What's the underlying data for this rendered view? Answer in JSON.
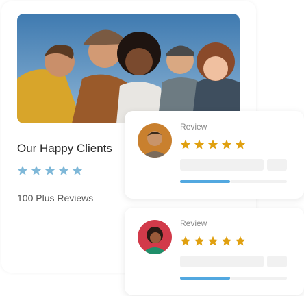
{
  "showcase": {
    "title": "Our Happy Clients",
    "rating_stars": 5,
    "review_count_text": "100 Plus Reviews",
    "star_color": "#7fb8d8"
  },
  "reviews": [
    {
      "label": "Review",
      "rating_stars": 5,
      "star_color": "#e0a010"
    },
    {
      "label": "Review",
      "rating_stars": 5,
      "star_color": "#e0a010"
    }
  ],
  "colors": {
    "accent_bar": "#52a8e0",
    "skeleton": "#f1f1f1",
    "text_dark": "#2b2b2b",
    "text_muted": "#8a8a8a"
  }
}
